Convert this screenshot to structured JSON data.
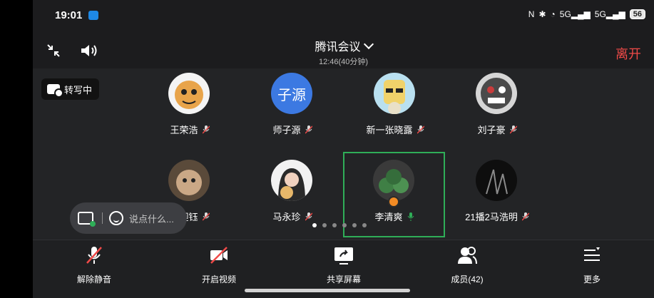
{
  "status_bar": {
    "time": "19:01",
    "network_label": "5G",
    "battery": "56"
  },
  "meeting": {
    "title": "腾讯会议",
    "time_info": "12:46(40分钟)",
    "leave_label": "离开"
  },
  "transcribe_badge": {
    "label": "转写中"
  },
  "participants": [
    {
      "name": "王荣浩",
      "muted": true
    },
    {
      "name": "师子源",
      "avatar_text": "子源",
      "muted": true
    },
    {
      "name": "新一张晓露",
      "muted": true
    },
    {
      "name": "刘子豪",
      "muted": true
    },
    {
      "name": "崔迎钰",
      "muted": true
    },
    {
      "name": "马永珍",
      "muted": true
    },
    {
      "name": "李清爽",
      "muted": false,
      "speaking": true
    },
    {
      "name": "21播2马浩明",
      "muted": true
    }
  ],
  "chat": {
    "placeholder": "说点什么..."
  },
  "pager": {
    "total": 6,
    "active_index": 0
  },
  "toolbar": [
    {
      "label": "解除静音",
      "icon": "mic-off-icon"
    },
    {
      "label": "开启视频",
      "icon": "video-off-icon"
    },
    {
      "label": "共享屏幕",
      "icon": "share-screen-icon"
    },
    {
      "label": "成员(42)",
      "icon": "members-icon"
    },
    {
      "label": "更多",
      "icon": "more-icon"
    }
  ],
  "colors": {
    "accent_red": "#f04a48",
    "speaking_green": "#2fae58",
    "avatar_blue": "#3c79e2"
  }
}
